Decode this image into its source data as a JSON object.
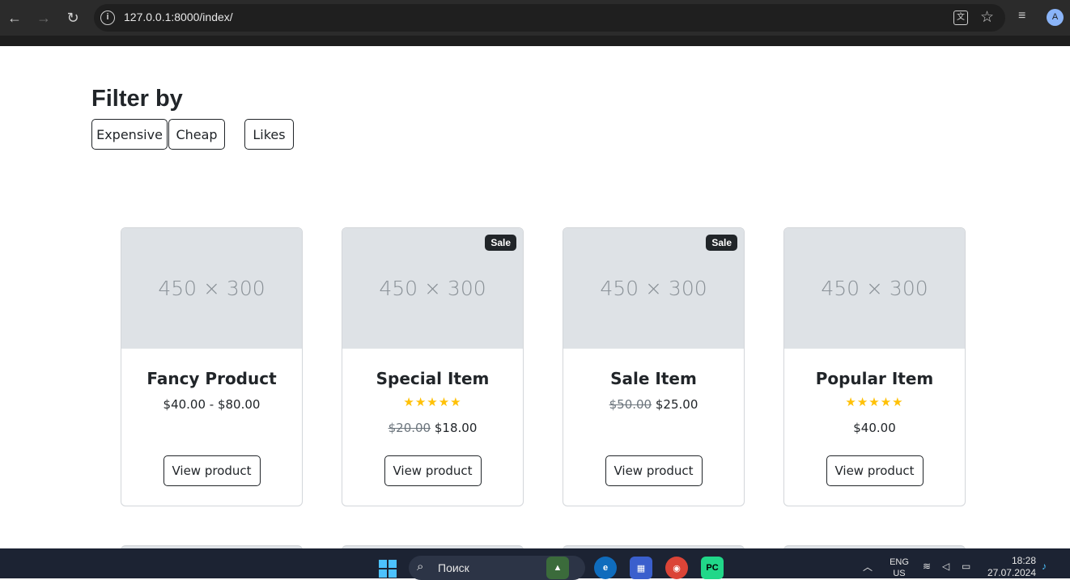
{
  "browser": {
    "url": "127.0.0.1:8000/index/"
  },
  "filter": {
    "title": "Filter by",
    "buttons": [
      "Expensive",
      "Cheap",
      "Likes"
    ]
  },
  "products": [
    {
      "placeholder": "450 × 300",
      "badge": "",
      "name": "Fancy Product",
      "rating_stars": "",
      "old_price": "",
      "price": "$40.00 - $80.00",
      "button": "View product"
    },
    {
      "placeholder": "450 × 300",
      "badge": "Sale",
      "name": "Special Item",
      "rating_stars": "★★★★★",
      "rating": 5,
      "old_price": "$20.00",
      "price": "$18.00",
      "button": "View product"
    },
    {
      "placeholder": "450 × 300",
      "badge": "Sale",
      "name": "Sale Item",
      "rating_stars": "",
      "old_price": "$50.00",
      "price": "$25.00",
      "button": "View product"
    },
    {
      "placeholder": "450 × 300",
      "badge": "",
      "name": "Popular Item",
      "rating_stars": "★★★★★",
      "rating": 5,
      "old_price": "",
      "price": "$40.00",
      "button": "View product"
    }
  ],
  "taskbar": {
    "search_placeholder": "Поиск",
    "language_line1": "ENG",
    "language_line2": "US",
    "time": "18:28",
    "date": "27.07.2024"
  },
  "colors": {
    "badge": "#212529",
    "star": "#ffc107",
    "image_placeholder": "#dee2e6"
  }
}
